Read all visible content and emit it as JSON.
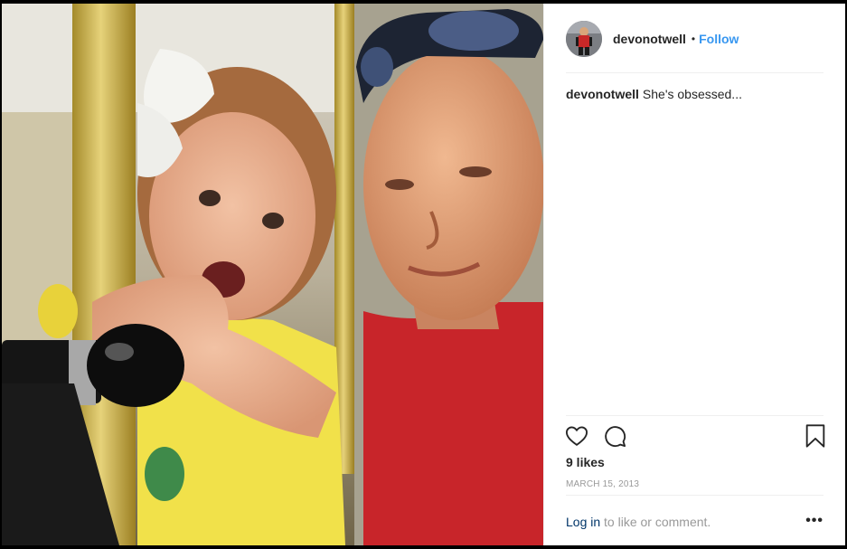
{
  "post": {
    "username": "devonotwell",
    "separator": "•",
    "follow_label": "Follow",
    "caption_user": "devonotwell",
    "caption_text": "She's obsessed...",
    "likes": "9 likes",
    "date": "MARCH 15, 2013",
    "login_link": "Log in",
    "login_suffix": " to like or comment.",
    "more_label": "•••"
  },
  "icons": {
    "like": "heart-icon",
    "comment": "comment-icon",
    "save": "bookmark-icon",
    "options": "more-options-icon"
  },
  "colors": {
    "link_blue": "#3897f0",
    "text": "#262626",
    "muted": "#999999",
    "divider": "#efefef"
  }
}
